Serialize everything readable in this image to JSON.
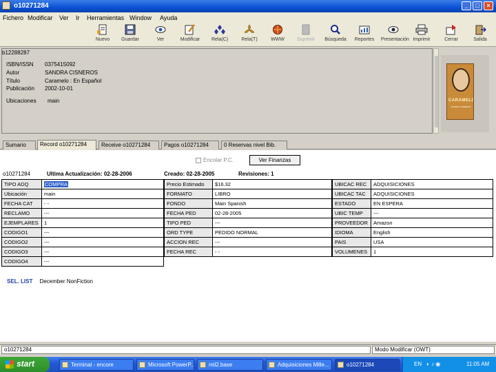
{
  "window": {
    "title": "o10271284"
  },
  "menu": [
    "Fichero",
    "Modificar",
    "Ver",
    "Ir",
    "Herramientas",
    "Window",
    "Ayuda"
  ],
  "toolbar": [
    {
      "label": "Nuevo",
      "icon": "new-record-icon",
      "disabled": false
    },
    {
      "label": "Guardar",
      "icon": "save-icon",
      "disabled": false
    },
    {
      "label": "Ver",
      "icon": "view-eye-icon",
      "disabled": false
    },
    {
      "label": "Modificar",
      "icon": "edit-icon",
      "disabled": false
    },
    {
      "label": "Rela(C)",
      "icon": "relate-icon",
      "disabled": false
    },
    {
      "label": "Rela(T)",
      "icon": "relate-alt-icon",
      "disabled": false
    },
    {
      "label": "WWW",
      "icon": "web-icon",
      "disabled": false
    },
    {
      "label": "Suprimir",
      "icon": "delete-icon",
      "disabled": true
    },
    {
      "label": "Búsqueda",
      "icon": "search-icon",
      "disabled": false
    },
    {
      "label": "Reportes",
      "icon": "reports-icon",
      "disabled": false
    },
    {
      "label": "Presentación",
      "icon": "preview-icon",
      "disabled": false
    },
    {
      "label": "Imprimir",
      "icon": "print-icon",
      "disabled": false
    },
    {
      "label": "Cerrar",
      "icon": "close-record-icon",
      "disabled": false
    },
    {
      "label": "Salida",
      "icon": "exit-icon",
      "disabled": false
    }
  ],
  "bib": {
    "record_id": "b12288287",
    "fields": [
      {
        "label": "ISBN/ISSN",
        "value": "0375415092"
      },
      {
        "label": "Autor",
        "value": "SANDRA CISNEROS"
      },
      {
        "label": "Título",
        "value": "Caramelo : En Español"
      },
      {
        "label": "Publicación",
        "value": "2002-10-01"
      },
      {
        "label": "Ubicaciones",
        "value": "main"
      }
    ],
    "cover": {
      "title": "CARAMELO",
      "author": "SANDRA CISNEROS"
    }
  },
  "tabs": [
    "Sumario",
    "Record o10271284",
    "Receive o10271284",
    "Pagos o10271284",
    "0 Reservas nivel Bib."
  ],
  "active_tab": 1,
  "finance": {
    "checkbox_label": "Encolar P.C.",
    "button_label": "Ver Finanzas"
  },
  "order_info": {
    "record_id": "o10271284",
    "last_updated": "Ultima Actualización: 02-28-2006",
    "created": "Creado: 02-28-2005",
    "revisions": "Revisiones: 1"
  },
  "grid1": [
    {
      "label": "TIPO ADQ",
      "value": "COMPRA"
    },
    {
      "label": "Ubicación",
      "value": "main"
    },
    {
      "label": "FECHA CAT",
      "value": "- -"
    },
    {
      "label": "RECLAMO",
      "value": "---"
    },
    {
      "label": "EJEMPLARES",
      "value": "1"
    },
    {
      "label": "CODIGO1",
      "value": "---"
    },
    {
      "label": "CODIGO2",
      "value": "---"
    },
    {
      "label": "CODIGO3",
      "value": "---"
    },
    {
      "label": "CODIGO4",
      "value": "---"
    }
  ],
  "grid2": [
    {
      "label": "Precio Estimado",
      "value": "$16.32"
    },
    {
      "label": "FORMATO",
      "value": "LIBRO"
    },
    {
      "label": "FONDO",
      "value": "Main Spanish"
    },
    {
      "label": "FECHA PED",
      "value": "02-28-2005"
    },
    {
      "label": "TIPO PED",
      "value": "---"
    },
    {
      "label": "ORD TYPE",
      "value": "PEDIDO NORMAL"
    },
    {
      "label": "ACCION REC",
      "value": "---"
    },
    {
      "label": "FECHA REC",
      "value": "- -"
    }
  ],
  "grid3": [
    {
      "label": "UBICAC REC",
      "value": "ADQUISICIONES"
    },
    {
      "label": "UBICAC TAC",
      "value": "ADQUISICIONES"
    },
    {
      "label": "ESTADO",
      "value": "EN ESPERA"
    },
    {
      "label": "UBIC TEMP",
      "value": "---"
    },
    {
      "label": "PROVEEDOR",
      "value": "Amazon"
    },
    {
      "label": "IDIOMA",
      "value": "English"
    },
    {
      "label": "PAIS",
      "value": "USA"
    },
    {
      "label": "VOLUMENES",
      "value": "1"
    }
  ],
  "sel_list": {
    "label": "SEL. LIST",
    "value": "December NonFiction"
  },
  "status": {
    "left": "o10271284",
    "right": "Modo Modificar (OWT)"
  },
  "taskbar": {
    "start": "start",
    "tasks": [
      {
        "label": "Terminal - encore",
        "active": false
      },
      {
        "label": "Microsoft PowerP...",
        "active": false
      },
      {
        "label": "mil2.base",
        "active": false
      },
      {
        "label": "Adquisiciones Mille...",
        "active": false
      },
      {
        "label": "o10271284",
        "active": true
      }
    ],
    "lang": "EN",
    "clock": "11:05 AM"
  }
}
